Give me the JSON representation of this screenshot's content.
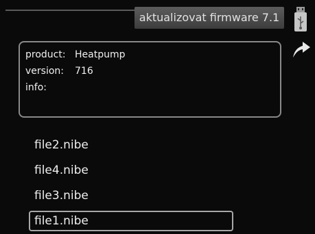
{
  "header": {
    "title": "aktualizovat firmware 7.1"
  },
  "icons": {
    "top": "usb-icon",
    "second": "back-arrow-icon"
  },
  "info": {
    "product_label": "product:",
    "product_value": "Heatpump",
    "version_label": "version:",
    "version_value": "716",
    "info_label": "info:",
    "info_value": ""
  },
  "files": [
    {
      "name": "file2.nibe",
      "selected": false
    },
    {
      "name": "file4.nibe",
      "selected": false
    },
    {
      "name": "file3.nibe",
      "selected": false
    },
    {
      "name": "file1.nibe",
      "selected": true
    }
  ],
  "colors": {
    "background": "#0a0a0a",
    "frame": "#8a8a8a",
    "text": "#eeeeee"
  }
}
